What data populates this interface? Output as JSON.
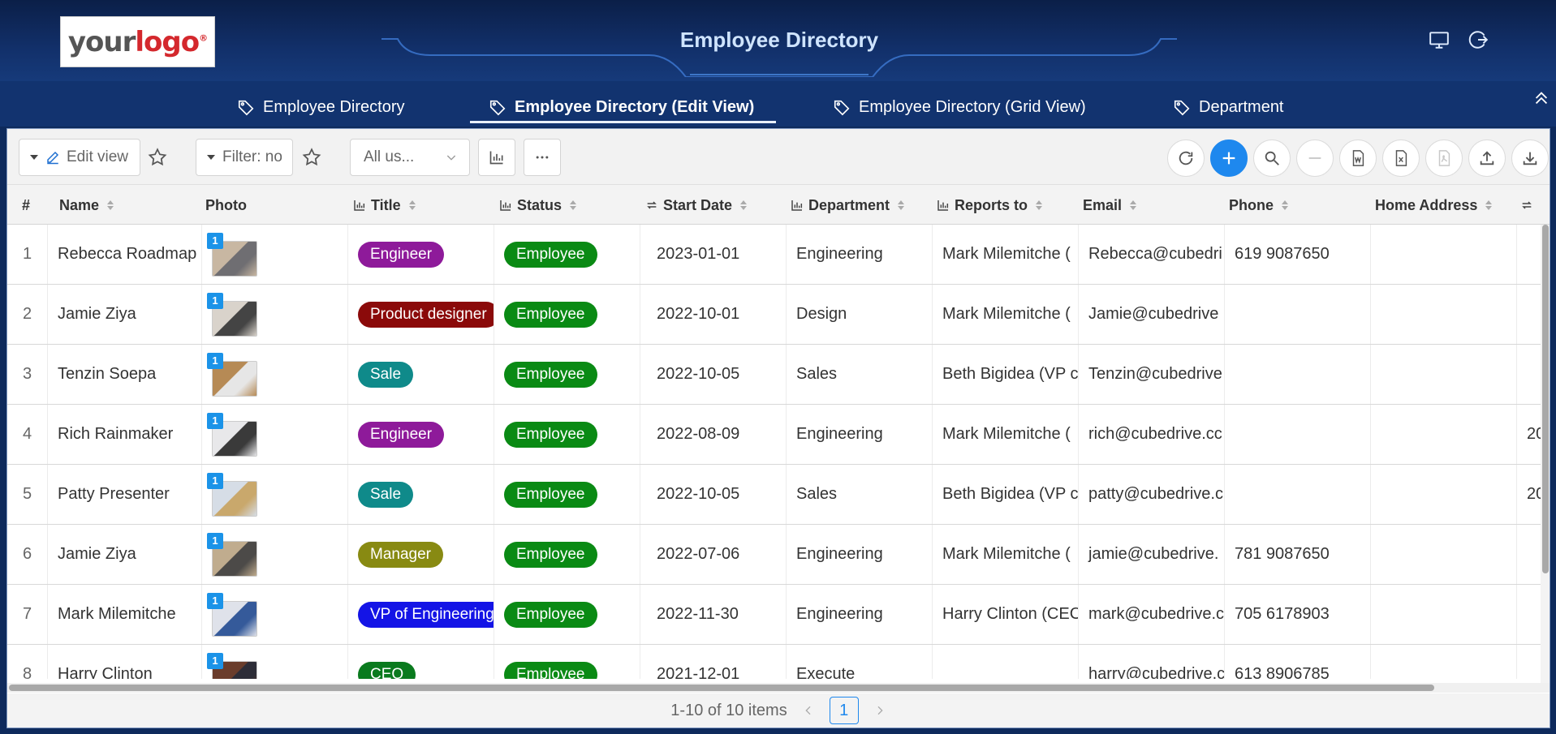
{
  "header": {
    "logo_your": "your",
    "logo_logo": "logo",
    "logo_reg": "®",
    "title": "Employee Directory"
  },
  "tabs": [
    {
      "label": "Employee Directory"
    },
    {
      "label": "Employee Directory (Edit View)",
      "active": true
    },
    {
      "label": "Employee Directory (Grid View)"
    },
    {
      "label": "Department"
    }
  ],
  "toolbar": {
    "edit_view": "Edit view",
    "filter": "Filter: no",
    "scope": "All us..."
  },
  "columns": [
    "#",
    "Name",
    "Photo",
    "Title",
    "Status",
    "Start Date",
    "Department",
    "Reports to",
    "Email",
    "Phone",
    "Home Address"
  ],
  "rows": [
    {
      "num": "1",
      "name": "Rebecca Roadmap",
      "title": "Engineer",
      "title_color": "#8e1a9a",
      "status": "Employee",
      "start": "2023-01-01",
      "dept": "Engineering",
      "reports": "Mark Milemitche (",
      "email": "Rebecca@cubedri",
      "phone": "619 9087650",
      "extra": ""
    },
    {
      "num": "2",
      "name": "Jamie Ziya",
      "title": "Product designer",
      "title_color": "#8b0a0a",
      "status": "Employee",
      "start": "2022-10-01",
      "dept": "Design",
      "reports": "Mark Milemitche (",
      "email": "Jamie@cubedrive",
      "phone": "",
      "extra": ""
    },
    {
      "num": "3",
      "name": "Tenzin Soepa",
      "title": "Sale",
      "title_color": "#0f8a8a",
      "status": "Employee",
      "start": "2022-10-05",
      "dept": "Sales",
      "reports": "Beth Bigidea (VP c",
      "email": "Tenzin@cubedrive",
      "phone": "",
      "extra": ""
    },
    {
      "num": "4",
      "name": "Rich Rainmaker",
      "title": "Engineer",
      "title_color": "#8e1a9a",
      "status": "Employee",
      "start": "2022-08-09",
      "dept": "Engineering",
      "reports": "Mark Milemitche (",
      "email": "rich@cubedrive.cc",
      "phone": "",
      "extra": "20"
    },
    {
      "num": "5",
      "name": "Patty Presenter",
      "title": "Sale",
      "title_color": "#0f8a8a",
      "status": "Employee",
      "start": "2022-10-05",
      "dept": "Sales",
      "reports": "Beth Bigidea (VP c",
      "email": "patty@cubedrive.c",
      "phone": "",
      "extra": "20"
    },
    {
      "num": "6",
      "name": "Jamie Ziya",
      "title": "Manager",
      "title_color": "#888a12",
      "status": "Employee",
      "start": "2022-07-06",
      "dept": "Engineering",
      "reports": "Mark Milemitche (",
      "email": "jamie@cubedrive.",
      "phone": "781 9087650",
      "extra": ""
    },
    {
      "num": "7",
      "name": "Mark Milemitche",
      "title": "VP of Engineering",
      "title_color": "#1414e6",
      "status": "Employee",
      "start": "2022-11-30",
      "dept": "Engineering",
      "reports": "Harry Clinton (CEC",
      "email": "mark@cubedrive.c",
      "phone": "705 6178903",
      "extra": ""
    },
    {
      "num": "8",
      "name": "Harry Clinton",
      "title": "CEO",
      "title_color": "#0a7a1e",
      "status": "Employee",
      "start": "2021-12-01",
      "dept": "Execute",
      "reports": "",
      "email": "harry@cubedrive.c",
      "phone": "613 8906785",
      "extra": ""
    }
  ],
  "photo_badge": "1",
  "status_color": "#0a8a14",
  "pagination": {
    "summary": "1-10 of 10 items",
    "page": "1"
  }
}
